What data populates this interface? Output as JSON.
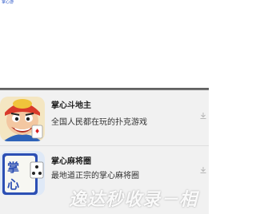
{
  "header": {
    "link_text": "掌心游"
  },
  "apps": [
    {
      "name": "掌心斗地主",
      "desc": "全国人民都在玩的扑克游戏",
      "icon": "doudizhu-character-icon",
      "download_icon": "download-icon"
    },
    {
      "name": "掌心麻将圈",
      "desc": "最地道正宗的掌心麻将圈",
      "icon": "mahjong-tile-icon",
      "download_icon": "download-icon"
    }
  ],
  "watermark": {
    "text": "逸达秒收录－相"
  },
  "colors": {
    "link": "#2b56c8",
    "list_bg": "#f1f1f1",
    "divider": "#666666",
    "mahjong_blue": "#2c4fb4"
  }
}
